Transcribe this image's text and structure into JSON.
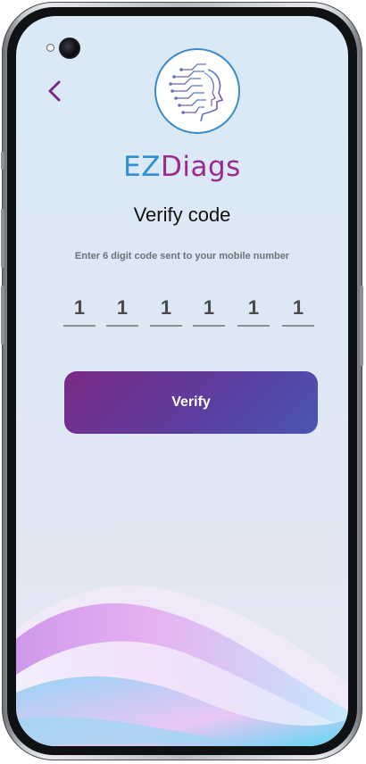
{
  "app": {
    "brand_ez": "EZ",
    "brand_diags": "Diags"
  },
  "page": {
    "title": "Verify code",
    "subtitle": "Enter 6 digit code sent to your mobile number"
  },
  "otp": {
    "digits": [
      "1",
      "1",
      "1",
      "1",
      "1",
      "1"
    ]
  },
  "actions": {
    "verify_label": "Verify"
  },
  "icons": {
    "back": "chevron-left-icon",
    "logo": "head-circuit-logo-icon"
  },
  "colors": {
    "accent_purple": "#7a2a86",
    "accent_blue": "#2f8fd3",
    "brand_magenta": "#9a2a8e",
    "button_gradient_end": "#4857b2"
  }
}
